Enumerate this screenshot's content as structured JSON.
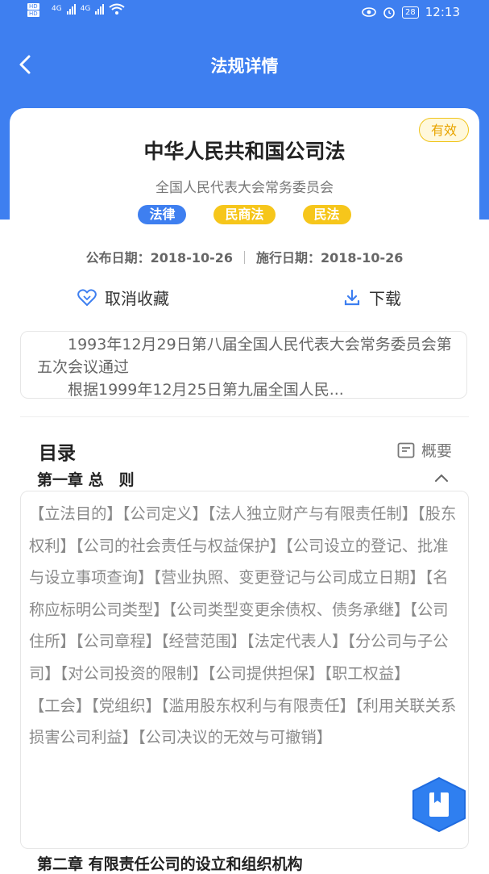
{
  "status_bar": {
    "hd1": "HD",
    "hd2": "HD",
    "net1": "4G",
    "net2": "4G",
    "battery": "28",
    "time": "12:13"
  },
  "nav": {
    "title": "法规详情"
  },
  "law": {
    "status": "有效",
    "title": "中华人民共和国公司法",
    "issuer": "全国人民代表大会常务委员会",
    "tags": [
      "法律",
      "民商法",
      "民法"
    ],
    "publish_label": "公布日期：",
    "publish_date": "2018-10-26",
    "effective_label": "施行日期：",
    "effective_date": "2018-10-26"
  },
  "actions": {
    "favorite": "取消收藏",
    "download": "下载"
  },
  "preamble": {
    "line1": "1993年12月29日第八届全国人民代表大会常务委员会第五次会议通过",
    "line2": "根据1999年12月25日第九届全国人民..."
  },
  "toc": {
    "title": "目录",
    "summary": "概要",
    "chapter1": "第一章 总　则",
    "chapter1_items": [
      "【立法目的】",
      "【公司定义】",
      "【法人独立财产与有限责任制】",
      "【股东权利】",
      "【公司的社会责任与权益保护】",
      "【公司设立的登记、批准与设立事项查询】",
      "【营业执照、变更登记与公司成立日期】",
      "【名称应标明公司类型】",
      "【公司类型变更余债权、债务承继】",
      "【公司住所】",
      "【公司章程】",
      "【经营范围】",
      "【法定代表人】",
      "【分公司与子公司】",
      "【对公司投资的限制】",
      "【公司提供担保】",
      "【职工权益】",
      "【工会】",
      "【党组织】",
      "【滥用股东权利与有限责任】",
      "【利用关联关系损害公司利益】",
      "【公司决议的无效与可撤销】"
    ],
    "chapter2": "第二章 有限责任公司的设立和组织机构"
  },
  "colors": {
    "primary": "#3e7ff0",
    "accent_yellow": "#f6c61b"
  },
  "icons": [
    "back-arrow-icon",
    "heart-icon",
    "download-icon",
    "summary-icon",
    "chevron-up-icon",
    "bookmark-icon"
  ]
}
